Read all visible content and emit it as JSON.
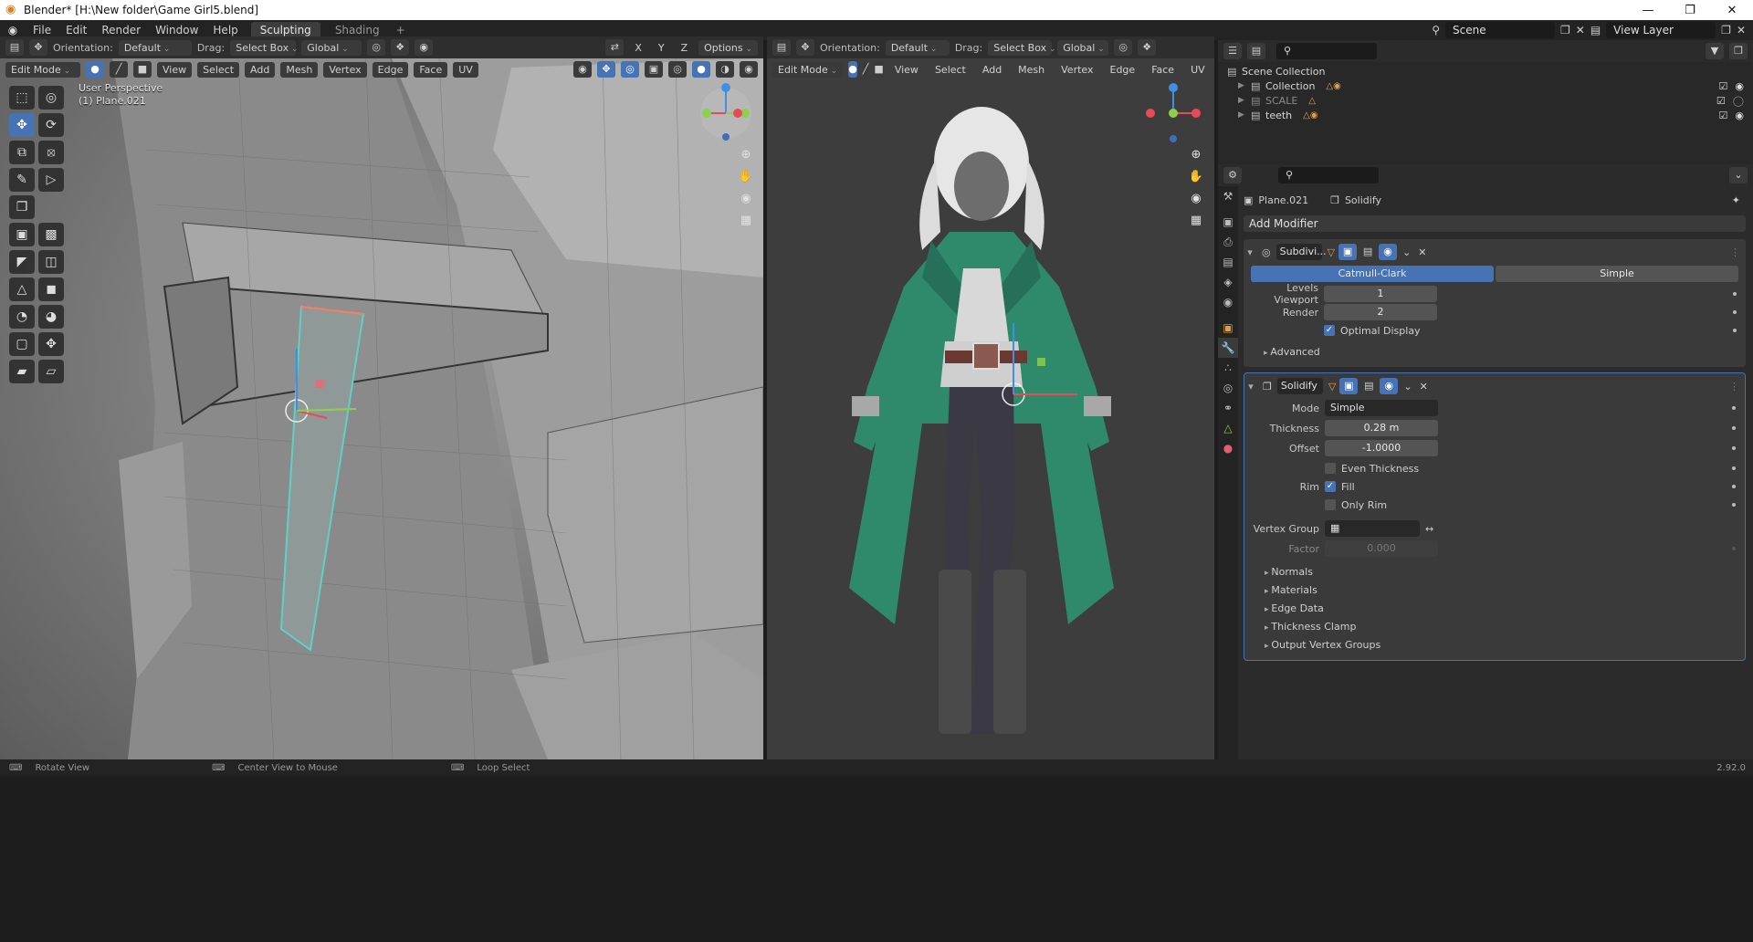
{
  "titlebar": {
    "title": "Blender* [H:\\New folder\\Game Girl5.blend]"
  },
  "menubar": {
    "items": [
      "File",
      "Edit",
      "Render",
      "Window",
      "Help"
    ],
    "workspaces": [
      "Sculpting",
      "Shading"
    ],
    "scene_label": "Scene",
    "view_layer_label": "View Layer"
  },
  "left_view": {
    "header": {
      "orientation_label": "Orientation:",
      "orientation_value": "Default",
      "drag_label": "Drag:",
      "drag_value": "Select Box",
      "transform_value": "Global",
      "axes": [
        "X",
        "Y",
        "Z"
      ],
      "options_label": "Options"
    },
    "header2": {
      "mode": "Edit Mode",
      "menus": [
        "View",
        "Select",
        "Add",
        "Mesh",
        "Vertex",
        "Edge",
        "Face",
        "UV"
      ]
    },
    "overlay": {
      "perspective": "User Perspective",
      "object": "(1) Plane.021"
    }
  },
  "right_view": {
    "header": {
      "orientation_label": "Orientation:",
      "orientation_value": "Default",
      "drag_label": "Drag:",
      "drag_value": "Select Box",
      "transform_value": "Global"
    },
    "header2": {
      "mode": "Edit Mode",
      "menus": [
        "View",
        "Select",
        "Add",
        "Mesh",
        "Vertex",
        "Edge",
        "Face",
        "UV"
      ]
    }
  },
  "outliner": {
    "root": "Scene Collection",
    "rows": [
      {
        "label": "Collection",
        "dim": false
      },
      {
        "label": "SCALE",
        "dim": true
      },
      {
        "label": "teeth",
        "dim": false
      }
    ]
  },
  "properties": {
    "object_name": "Plane.021",
    "modifier_name": "Solidify",
    "add_modifier": "Add Modifier",
    "subdiv": {
      "name": "Subdivi...",
      "modes": [
        "Catmull-Clark",
        "Simple"
      ],
      "levels_label": "Levels Viewport",
      "levels_value": "1",
      "render_label": "Render",
      "render_value": "2",
      "optimal_label": "Optimal Display",
      "advanced_label": "Advanced"
    },
    "solidify": {
      "name": "Solidify",
      "mode_label": "Mode",
      "mode_value": "Simple",
      "thickness_label": "Thickness",
      "thickness_value": "0.28 m",
      "offset_label": "Offset",
      "offset_value": "-1.0000",
      "even_label": "Even Thickness",
      "rim_label": "Rim",
      "fill_label": "Fill",
      "only_rim_label": "Only Rim",
      "vgroup_label": "Vertex Group",
      "factor_label": "Factor",
      "factor_value": "0.000",
      "subpanels": [
        "Normals",
        "Materials",
        "Edge Data",
        "Thickness Clamp",
        "Output Vertex Groups"
      ]
    }
  },
  "statusbar": {
    "items": [
      "Rotate View",
      "Center View to Mouse",
      "Loop Select"
    ],
    "version": "2.92.0"
  },
  "colors": {
    "accent": "#4772b3",
    "selection": "#5fd1c4",
    "coat": "#2e8a6a"
  }
}
